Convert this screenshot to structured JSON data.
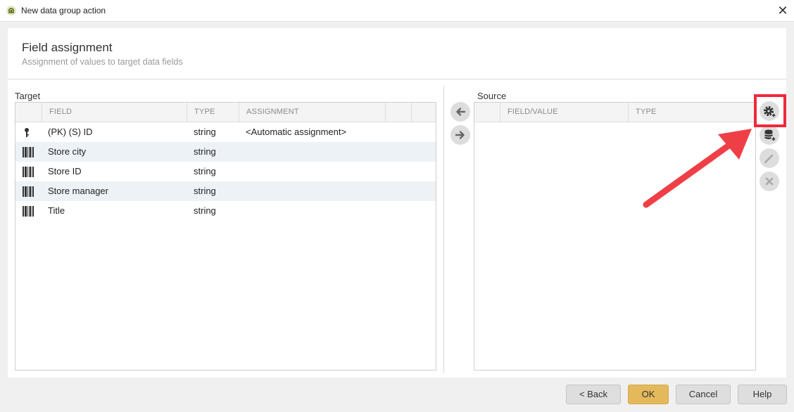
{
  "window": {
    "title": "New data group action",
    "close_icon": "close-icon"
  },
  "header": {
    "title": "Field assignment",
    "subtitle": "Assignment of values to target data fields"
  },
  "target": {
    "label": "Target",
    "columns": [
      "FIELD",
      "TYPE",
      "ASSIGNMENT"
    ],
    "rows": [
      {
        "icon": "key-icon",
        "field": "(PK) (S) ID",
        "type": "string",
        "assignment": "<Automatic assignment>"
      },
      {
        "icon": "barcode-icon",
        "field": "Store city",
        "type": "string",
        "assignment": ""
      },
      {
        "icon": "barcode-icon",
        "field": "Store ID",
        "type": "string",
        "assignment": ""
      },
      {
        "icon": "barcode-icon",
        "field": "Store manager",
        "type": "string",
        "assignment": ""
      },
      {
        "icon": "barcode-icon",
        "field": "Title",
        "type": "string",
        "assignment": ""
      }
    ]
  },
  "source": {
    "label": "Source",
    "columns": [
      "FIELD/VALUE",
      "TYPE"
    ]
  },
  "middle_buttons": [
    "arrow-left-icon",
    "arrow-right-icon"
  ],
  "side_buttons": [
    "gear-add-icon",
    "database-add-icon",
    "pencil-icon",
    "x-icon"
  ],
  "footer": {
    "back": "< Back",
    "ok": "OK",
    "cancel": "Cancel",
    "help": "Help"
  },
  "colors": {
    "highlight": "#ee2a3a",
    "arrow": "#ef3f46",
    "ok_button": "#e3b95c",
    "row_alt": "#edf2f6"
  }
}
